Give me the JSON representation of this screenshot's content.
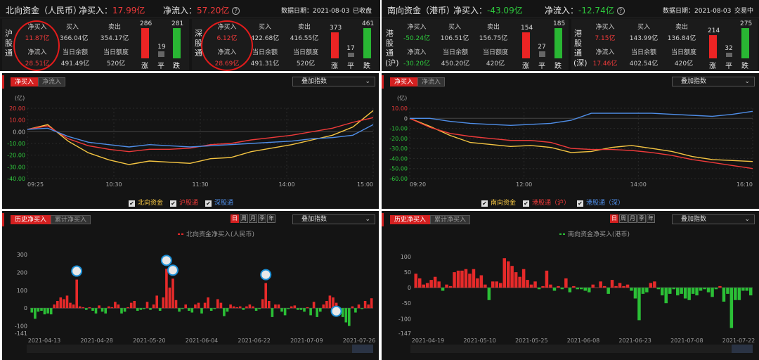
{
  "north": {
    "title": "北向资金（人民币）",
    "net_buy_label": "净买入：",
    "net_buy_value": "17.99亿",
    "net_inflow_label": "净流入：",
    "net_inflow_value": "57.20亿",
    "help_glyph": "?",
    "date_label": "数据日期：",
    "date_value": "2021-08-03",
    "status": "已收盘",
    "rise_label": "涨",
    "flat_label": "平",
    "fall_label": "跌",
    "sh": {
      "label": "沪股通",
      "net_buy_label": "净买入",
      "net_buy_value": "11.87亿",
      "net_inflow_label": "净流入",
      "net_inflow_value": "28.51亿",
      "buy_label": "买入",
      "buy_value": "366.04亿",
      "sell_label": "卖出",
      "sell_value": "354.17亿",
      "balance_label": "当日余额",
      "balance_value": "491.49亿",
      "quota_label": "当日额度",
      "quota_value": "520亿",
      "up": "286",
      "flat": "19",
      "down": "281"
    },
    "sz": {
      "label": "深股通",
      "net_buy_label": "净买入",
      "net_buy_value": "6.12亿",
      "net_inflow_label": "净流入",
      "net_inflow_value": "28.69亿",
      "buy_label": "买入",
      "buy_value": "422.68亿",
      "sell_label": "卖出",
      "sell_value": "416.55亿",
      "balance_label": "当日余额",
      "balance_value": "491.31亿",
      "quota_label": "当日额度",
      "quota_value": "520亿",
      "up": "373",
      "flat": "17",
      "down": "461"
    }
  },
  "south": {
    "title": "南向资金（港币）",
    "net_buy_label": "净买入：",
    "net_buy_value": "-43.09亿",
    "net_inflow_label": "净流入：",
    "net_inflow_value": "-12.74亿",
    "help_glyph": "?",
    "date_label": "数据日期：",
    "date_value": "2021-08-03",
    "status": "交易中",
    "rise_label": "涨",
    "flat_label": "平",
    "fall_label": "跌",
    "hs": {
      "label": "港股通(沪)",
      "net_buy_label": "净买入",
      "net_buy_value": "-50.24亿",
      "net_inflow_label": "净流入",
      "net_inflow_value": "-30.20亿",
      "buy_label": "买入",
      "buy_value": "106.51亿",
      "sell_label": "卖出",
      "sell_value": "156.75亿",
      "balance_label": "当日余额",
      "balance_value": "450.20亿",
      "quota_label": "当日额度",
      "quota_value": "420亿",
      "up": "154",
      "flat": "27",
      "down": "185"
    },
    "hz": {
      "label": "港股通(深)",
      "net_buy_label": "净买入",
      "net_buy_value": "7.15亿",
      "net_inflow_label": "净流入",
      "net_inflow_value": "17.46亿",
      "buy_label": "买入",
      "buy_value": "143.99亿",
      "sell_label": "卖出",
      "sell_value": "136.84亿",
      "balance_label": "当日余额",
      "balance_value": "402.54亿",
      "quota_label": "当日额度",
      "quota_value": "420亿",
      "up": "214",
      "flat": "32",
      "down": "275"
    }
  },
  "north_intraday": {
    "tabs": [
      "净买入",
      "净流入"
    ],
    "overlay": "叠加指数",
    "legend": [
      "北向资金",
      "沪股通",
      "深股通"
    ]
  },
  "south_intraday": {
    "tabs": [
      "净买入",
      "净流入"
    ],
    "overlay": "叠加指数",
    "legend": [
      "南向资金",
      "港股通（沪）",
      "港股通（深）"
    ]
  },
  "north_hist": {
    "tabs": [
      "历史净买入",
      "累计净买入"
    ],
    "periods": [
      "日",
      "周",
      "月",
      "季",
      "年"
    ],
    "overlay": "叠加指数"
  },
  "south_hist": {
    "tabs": [
      "历史净买入",
      "累计净买入"
    ],
    "periods": [
      "日",
      "周",
      "月",
      "季",
      "年"
    ],
    "overlay": "叠加指数"
  },
  "chart_data": [
    {
      "type": "line",
      "unit_label": "(亿)",
      "x_ticks": [
        "09:25",
        "10:30",
        "11:30",
        "14:00",
        "15:00"
      ],
      "x": [
        "09:25",
        "09:35",
        "09:45",
        "10:00",
        "10:15",
        "10:30",
        "10:45",
        "11:00",
        "11:15",
        "11:30",
        "13:15",
        "13:30",
        "13:45",
        "14:00",
        "14:15",
        "14:30",
        "14:45",
        "15:00"
      ],
      "ylim": [
        -40,
        20
      ],
      "y_ticks": [
        20,
        10,
        0,
        -10,
        -20,
        -30,
        -40
      ],
      "y_tick_labels": [
        "20.00",
        "10.00",
        "0.00",
        "-10.00",
        "-20.00",
        "-30.00",
        "-40.00"
      ],
      "series": [
        {
          "name": "北向资金",
          "color": "#f5c542",
          "values": [
            2,
            6,
            -8,
            -18,
            -24,
            -28,
            -25,
            -26,
            -27,
            -23,
            -22,
            -17,
            -14,
            -11,
            -7,
            -3,
            4,
            18
          ]
        },
        {
          "name": "沪股通",
          "color": "#ef3a3a",
          "values": [
            2,
            5,
            -6,
            -12,
            -15,
            -17,
            -15,
            -15,
            -14,
            -11,
            -10,
            -7,
            -5,
            -3,
            0,
            3,
            8,
            12
          ]
        },
        {
          "name": "深股通",
          "color": "#4f8ee8",
          "values": [
            2,
            3,
            -4,
            -9,
            -11,
            -13,
            -11,
            -12,
            -13,
            -12,
            -11,
            -10,
            -9,
            -8,
            -6,
            -5,
            -3,
            6
          ]
        }
      ]
    },
    {
      "type": "line",
      "unit_label": "(亿)",
      "x_ticks": [
        "09:20",
        "12:00",
        "14:00",
        "16:10"
      ],
      "x": [
        "09:20",
        "09:40",
        "10:00",
        "10:20",
        "10:40",
        "11:00",
        "11:20",
        "11:40",
        "12:00",
        "13:00",
        "13:20",
        "13:40",
        "14:00",
        "14:20",
        "14:40",
        "15:00",
        "15:30",
        "16:10"
      ],
      "ylim": [
        -60,
        10
      ],
      "y_ticks": [
        10,
        0,
        -10,
        -20,
        -30,
        -40,
        -50,
        -60
      ],
      "y_tick_labels": [
        "10.00",
        "0",
        "-10.00",
        "-20.00",
        "-30.00",
        "-40.00",
        "-50.00",
        "-60.00"
      ],
      "series": [
        {
          "name": "南向资金",
          "color": "#f5c542",
          "values": [
            0,
            -8,
            -17,
            -24,
            -26,
            -28,
            -27,
            -29,
            -34,
            -33,
            -29,
            -27,
            -30,
            -33,
            -38,
            -41,
            -42,
            -43
          ]
        },
        {
          "name": "港股通（沪）",
          "color": "#ef3a3a",
          "values": [
            0,
            -9,
            -15,
            -18,
            -20,
            -22,
            -22,
            -24,
            -30,
            -31,
            -31,
            -32,
            -34,
            -37,
            -41,
            -44,
            -47,
            -50
          ]
        },
        {
          "name": "港股通（深）",
          "color": "#4f8ee8",
          "values": [
            0,
            0,
            -3,
            -5,
            -6,
            -7,
            -6,
            -5,
            -2,
            5,
            5,
            5,
            5,
            4,
            3,
            2,
            4,
            7
          ]
        }
      ]
    },
    {
      "type": "bar",
      "title": "北向资金净买入(人民币)",
      "ylim": [
        -141,
        300
      ],
      "y_ticks": [
        300,
        200,
        100,
        0,
        -100,
        -141
      ],
      "x_ticks": [
        "2021-04-13",
        "2021-04-28",
        "2021-05-20",
        "2021-06-04",
        "2021-06-22",
        "2021-07-09",
        "2021-07-26"
      ],
      "values": [
        -25,
        -60,
        -20,
        -15,
        -35,
        -30,
        -35,
        20,
        40,
        60,
        50,
        70,
        30,
        20,
        160,
        10,
        5,
        -10,
        5,
        -15,
        -30,
        15,
        -20,
        -30,
        10,
        5,
        35,
        20,
        -30,
        -20,
        5,
        30,
        40,
        -15,
        -10,
        -5,
        35,
        -10,
        20,
        70,
        -15,
        60,
        220,
        115,
        165,
        45,
        -20,
        -5,
        20,
        -15,
        -25,
        20,
        30,
        -30,
        30,
        60,
        -15,
        -5,
        50,
        30,
        -45,
        -20,
        20,
        10,
        5,
        10,
        -10,
        10,
        20,
        10,
        -15,
        -5,
        50,
        140,
        40,
        -50,
        20,
        20,
        -20,
        -40,
        -5,
        10,
        15,
        -10,
        -10,
        -20,
        5,
        -40,
        35,
        -50,
        -20,
        20,
        40,
        70,
        60,
        30,
        -20,
        -50,
        -80,
        -100,
        10,
        -25,
        20,
        -5,
        40,
        20,
        55
      ]
    },
    {
      "type": "bar",
      "title": "南向资金净买入(港币)",
      "ylim": [
        -147,
        100
      ],
      "y_ticks": [
        100,
        50,
        0,
        -50,
        -100,
        -147
      ],
      "x_ticks": [
        "2021-04-19",
        "2021-05-10",
        "2021-05-25",
        "2021-06-08",
        "2021-06-23",
        "2021-07-08",
        "2021-07-22"
      ],
      "values": [
        45,
        30,
        10,
        15,
        25,
        35,
        20,
        -10,
        10,
        5,
        50,
        55,
        55,
        60,
        45,
        60,
        30,
        40,
        10,
        -40,
        20,
        20,
        15,
        95,
        85,
        70,
        50,
        35,
        60,
        25,
        10,
        20,
        -5,
        5,
        55,
        10,
        -10,
        5,
        -5,
        30,
        -15,
        5,
        -5,
        -5,
        -10,
        -15,
        10,
        0,
        20,
        5,
        -20,
        25,
        5,
        15,
        5,
        10,
        -10,
        -35,
        -105,
        -20,
        -15,
        15,
        20,
        -5,
        -25,
        -50,
        -20,
        -5,
        -25,
        -20,
        -35,
        -40,
        -20,
        -25,
        -10,
        -5,
        -15,
        -30,
        -5,
        5,
        -45,
        -20,
        -130,
        -40,
        -40,
        -10,
        -10,
        -25
      ]
    }
  ]
}
